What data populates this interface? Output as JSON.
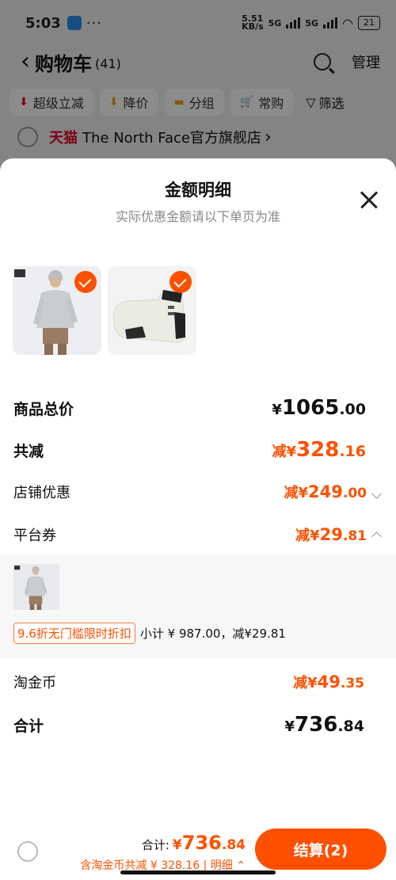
{
  "status": {
    "time": "5:03",
    "dots": "···",
    "net_speed": "5.51\nKB/s",
    "net1": "5G",
    "net2": "5G",
    "battery": "21"
  },
  "nav": {
    "back": "‹",
    "title": "购物车",
    "count": "(41)",
    "manage": "管理"
  },
  "filters": [
    {
      "icon": "super-discount-icon",
      "glyph": "⬇",
      "label": "超级立减"
    },
    {
      "icon": "price-drop-icon",
      "glyph": "⬇",
      "label": "降价"
    },
    {
      "icon": "folder-icon",
      "glyph": "▬",
      "label": "分组"
    },
    {
      "icon": "cart-icon",
      "glyph": "🛒",
      "label": "常购"
    }
  ],
  "filter_label": "筛选",
  "store": {
    "platform": "天猫",
    "name": "The North Face官方旗舰店",
    "arrow": "›"
  },
  "sheet": {
    "title": "金额明细",
    "subtitle": "实际优惠金额请以下单页为准"
  },
  "rows": {
    "total_label": "商品总价",
    "total_cur": "¥",
    "total_int": "1065",
    "total_dec": ".00",
    "reduce_label": "共减",
    "reduce_prefix": "减¥",
    "reduce_int": "328",
    "reduce_dec": ".16",
    "shop_label": "店铺优惠",
    "shop_prefix": "减¥",
    "shop_int": "249",
    "shop_dec": ".00",
    "platform_label": "平台券",
    "platform_prefix": "减¥",
    "platform_int": "29",
    "platform_dec": ".81",
    "coin_label": "淘金币",
    "coin_prefix": "减¥",
    "coin_int": "49",
    "coin_dec": ".35",
    "sum_label": "合计",
    "sum_cur": "¥",
    "sum_int": "736",
    "sum_dec": ".84"
  },
  "coupon": {
    "tag": "9.6折无门槛限时折扣",
    "detail": "小计 ¥ 987.00，减¥29.81"
  },
  "bottom": {
    "total_label": "合计:",
    "total_cur": "¥",
    "total_int": "736",
    "total_dec": ".84",
    "sub": "含淘金币共减 ¥ 328.16 | 明细",
    "sub_arrow": "⌃",
    "checkout": "结算(2)"
  },
  "colors": {
    "accent": "#ff5000",
    "tmall": "#e4002b"
  }
}
